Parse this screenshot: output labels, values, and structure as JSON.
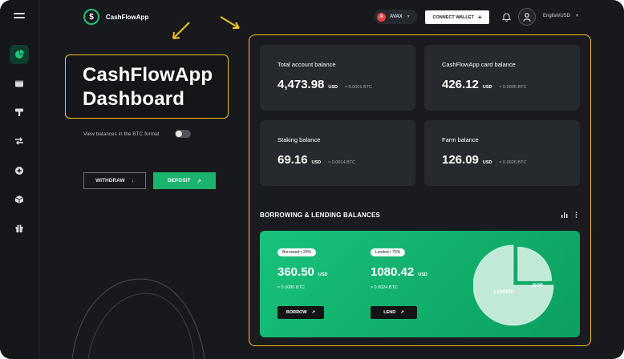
{
  "app": {
    "name": "CashFlowApp",
    "logo_symbol": "$"
  },
  "topbar": {
    "network": "AVAX",
    "network_symbol": "A",
    "connect_wallet": "CONNECT WALLET",
    "connect_plus": "+",
    "language": "English/USD"
  },
  "headline": {
    "line1": "CashFlowApp",
    "line2": "Dashboard"
  },
  "btc_toggle": {
    "label": "View balances in the BTC format",
    "enabled": false
  },
  "actions": {
    "withdraw": "WITHDRAW",
    "withdraw_arrow": "↓",
    "deposit": "DEPOSIT",
    "deposit_arrow": "↗"
  },
  "balances": [
    {
      "label": "Total account balance",
      "value": "4,473.98",
      "unit": "USD",
      "btc": "≈ 0.0001 BTC"
    },
    {
      "label": "CashFlowApp card balance",
      "value": "426.12",
      "unit": "USD",
      "btc": "≈ 0.0095 BTC"
    },
    {
      "label": "Staking balance",
      "value": "69.16",
      "unit": "USD",
      "btc": "≈ 0.0014 BTC"
    },
    {
      "label": "Farm balance",
      "value": "126.09",
      "unit": "USD",
      "btc": "≈ 0.0026 BTC"
    }
  ],
  "lending": {
    "title": "BORROWING & LENDING BALANCES",
    "borrowed": {
      "badge": "Borrowed • 25%",
      "value": "360.50",
      "unit": "USD",
      "btc": "≈ 0.0080 BTC",
      "button": "BORROW",
      "arrow": "↗"
    },
    "lended": {
      "badge": "Lended • 75%",
      "value": "1080.42",
      "unit": "USD",
      "btc": "≈ 0.0024 BTC",
      "button": "LEND",
      "arrow": "↗"
    },
    "pie": {
      "lended_label": "LENDED",
      "borrowed_label": "BOR",
      "lended_share": 0.75,
      "borrowed_share": 0.25
    }
  },
  "colors": {
    "accent": "#1bb36e",
    "highlight": "#f0c419",
    "background": "#17191d",
    "card": "#26292e"
  },
  "icons": [
    "menu-icon",
    "pie-chart-icon",
    "wallet-icon",
    "hammer-icon",
    "swap-icon",
    "plus-circle-icon",
    "box-icon",
    "gift-icon",
    "bell-icon",
    "user-icon",
    "bar-chart-icon",
    "more-icon"
  ]
}
